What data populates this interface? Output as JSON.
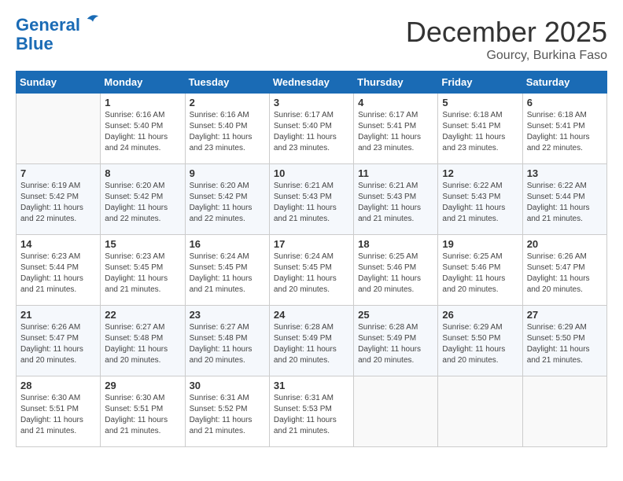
{
  "logo": {
    "line1": "General",
    "line2": "Blue"
  },
  "title": "December 2025",
  "subtitle": "Gourcy, Burkina Faso",
  "days_of_week": [
    "Sunday",
    "Monday",
    "Tuesday",
    "Wednesday",
    "Thursday",
    "Friday",
    "Saturday"
  ],
  "weeks": [
    [
      {
        "day": "",
        "info": ""
      },
      {
        "day": "1",
        "info": "Sunrise: 6:16 AM\nSunset: 5:40 PM\nDaylight: 11 hours\nand 24 minutes."
      },
      {
        "day": "2",
        "info": "Sunrise: 6:16 AM\nSunset: 5:40 PM\nDaylight: 11 hours\nand 23 minutes."
      },
      {
        "day": "3",
        "info": "Sunrise: 6:17 AM\nSunset: 5:40 PM\nDaylight: 11 hours\nand 23 minutes."
      },
      {
        "day": "4",
        "info": "Sunrise: 6:17 AM\nSunset: 5:41 PM\nDaylight: 11 hours\nand 23 minutes."
      },
      {
        "day": "5",
        "info": "Sunrise: 6:18 AM\nSunset: 5:41 PM\nDaylight: 11 hours\nand 23 minutes."
      },
      {
        "day": "6",
        "info": "Sunrise: 6:18 AM\nSunset: 5:41 PM\nDaylight: 11 hours\nand 22 minutes."
      }
    ],
    [
      {
        "day": "7",
        "info": "Sunrise: 6:19 AM\nSunset: 5:42 PM\nDaylight: 11 hours\nand 22 minutes."
      },
      {
        "day": "8",
        "info": "Sunrise: 6:20 AM\nSunset: 5:42 PM\nDaylight: 11 hours\nand 22 minutes."
      },
      {
        "day": "9",
        "info": "Sunrise: 6:20 AM\nSunset: 5:42 PM\nDaylight: 11 hours\nand 22 minutes."
      },
      {
        "day": "10",
        "info": "Sunrise: 6:21 AM\nSunset: 5:43 PM\nDaylight: 11 hours\nand 21 minutes."
      },
      {
        "day": "11",
        "info": "Sunrise: 6:21 AM\nSunset: 5:43 PM\nDaylight: 11 hours\nand 21 minutes."
      },
      {
        "day": "12",
        "info": "Sunrise: 6:22 AM\nSunset: 5:43 PM\nDaylight: 11 hours\nand 21 minutes."
      },
      {
        "day": "13",
        "info": "Sunrise: 6:22 AM\nSunset: 5:44 PM\nDaylight: 11 hours\nand 21 minutes."
      }
    ],
    [
      {
        "day": "14",
        "info": "Sunrise: 6:23 AM\nSunset: 5:44 PM\nDaylight: 11 hours\nand 21 minutes."
      },
      {
        "day": "15",
        "info": "Sunrise: 6:23 AM\nSunset: 5:45 PM\nDaylight: 11 hours\nand 21 minutes."
      },
      {
        "day": "16",
        "info": "Sunrise: 6:24 AM\nSunset: 5:45 PM\nDaylight: 11 hours\nand 21 minutes."
      },
      {
        "day": "17",
        "info": "Sunrise: 6:24 AM\nSunset: 5:45 PM\nDaylight: 11 hours\nand 20 minutes."
      },
      {
        "day": "18",
        "info": "Sunrise: 6:25 AM\nSunset: 5:46 PM\nDaylight: 11 hours\nand 20 minutes."
      },
      {
        "day": "19",
        "info": "Sunrise: 6:25 AM\nSunset: 5:46 PM\nDaylight: 11 hours\nand 20 minutes."
      },
      {
        "day": "20",
        "info": "Sunrise: 6:26 AM\nSunset: 5:47 PM\nDaylight: 11 hours\nand 20 minutes."
      }
    ],
    [
      {
        "day": "21",
        "info": "Sunrise: 6:26 AM\nSunset: 5:47 PM\nDaylight: 11 hours\nand 20 minutes."
      },
      {
        "day": "22",
        "info": "Sunrise: 6:27 AM\nSunset: 5:48 PM\nDaylight: 11 hours\nand 20 minutes."
      },
      {
        "day": "23",
        "info": "Sunrise: 6:27 AM\nSunset: 5:48 PM\nDaylight: 11 hours\nand 20 minutes."
      },
      {
        "day": "24",
        "info": "Sunrise: 6:28 AM\nSunset: 5:49 PM\nDaylight: 11 hours\nand 20 minutes."
      },
      {
        "day": "25",
        "info": "Sunrise: 6:28 AM\nSunset: 5:49 PM\nDaylight: 11 hours\nand 20 minutes."
      },
      {
        "day": "26",
        "info": "Sunrise: 6:29 AM\nSunset: 5:50 PM\nDaylight: 11 hours\nand 20 minutes."
      },
      {
        "day": "27",
        "info": "Sunrise: 6:29 AM\nSunset: 5:50 PM\nDaylight: 11 hours\nand 21 minutes."
      }
    ],
    [
      {
        "day": "28",
        "info": "Sunrise: 6:30 AM\nSunset: 5:51 PM\nDaylight: 11 hours\nand 21 minutes."
      },
      {
        "day": "29",
        "info": "Sunrise: 6:30 AM\nSunset: 5:51 PM\nDaylight: 11 hours\nand 21 minutes."
      },
      {
        "day": "30",
        "info": "Sunrise: 6:31 AM\nSunset: 5:52 PM\nDaylight: 11 hours\nand 21 minutes."
      },
      {
        "day": "31",
        "info": "Sunrise: 6:31 AM\nSunset: 5:53 PM\nDaylight: 11 hours\nand 21 minutes."
      },
      {
        "day": "",
        "info": ""
      },
      {
        "day": "",
        "info": ""
      },
      {
        "day": "",
        "info": ""
      }
    ]
  ]
}
